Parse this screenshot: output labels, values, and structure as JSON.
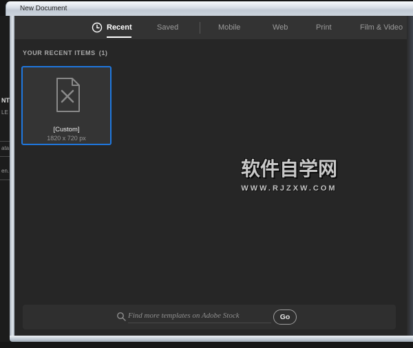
{
  "window": {
    "title": "New Document"
  },
  "tabs": {
    "items": [
      {
        "label": "Recent",
        "active": true
      },
      {
        "label": "Saved",
        "active": false
      },
      {
        "label": "Mobile",
        "active": false
      },
      {
        "label": "Web",
        "active": false
      },
      {
        "label": "Print",
        "active": false
      },
      {
        "label": "Film & Video",
        "active": false
      }
    ]
  },
  "recent_section": {
    "title": "YOUR RECENT ITEMS",
    "count": "(1)"
  },
  "recent_items": [
    {
      "name": "[Custom]",
      "dimensions": "1820 x 720 px",
      "selected": true
    }
  ],
  "watermark": {
    "title": "软件自学网",
    "url": "WWW.RJZXW.COM"
  },
  "stock_search": {
    "placeholder": "Find more templates on Adobe Stock",
    "go_label": "Go"
  },
  "background_window": {
    "fragments": [
      "NT",
      "LE",
      "ata",
      "en."
    ]
  },
  "icons": [
    "clock-icon",
    "search-icon",
    "document-blank-icon"
  ],
  "colors": {
    "selection_blue": "#1f78e0",
    "tab_bar": "#333333",
    "content_bg": "#262626",
    "titlebar_light": "#ccd4dd",
    "watermark_gray": "#c9c9c9"
  }
}
